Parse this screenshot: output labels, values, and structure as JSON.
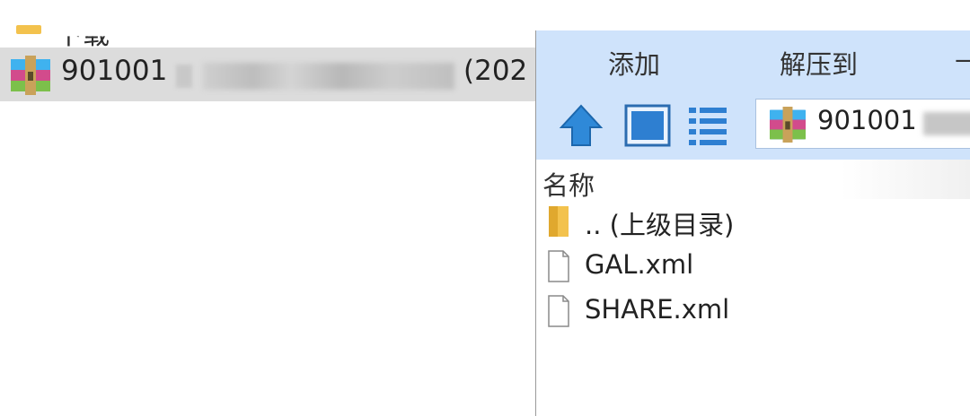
{
  "explorer": {
    "partial_item_label": "下载",
    "selected_file": {
      "name_prefix": "901001",
      "name_suffix": "(202",
      "icon": "winrar-archive-icon"
    }
  },
  "archive_window": {
    "menu": {
      "items": [
        "添加",
        "解压到",
        "—"
      ]
    },
    "toolbar": {
      "up_icon": "arrow-up-icon",
      "view_icon": "large-icons-view-icon",
      "details_icon": "details-view-icon",
      "address_path": "901001"
    },
    "list": {
      "column_header": "名称",
      "rows": [
        {
          "label": ".. (上级目录)",
          "icon": "folder-icon"
        },
        {
          "label": "GAL.xml",
          "icon": "file-icon"
        },
        {
          "label": "SHARE.xml",
          "icon": "file-icon"
        }
      ]
    }
  },
  "colors": {
    "toolbar_bg": "#cfe3fb",
    "selected_row_bg": "#dcdcdc",
    "folder": "#f3c24d",
    "arrow": "#2f89d8"
  }
}
